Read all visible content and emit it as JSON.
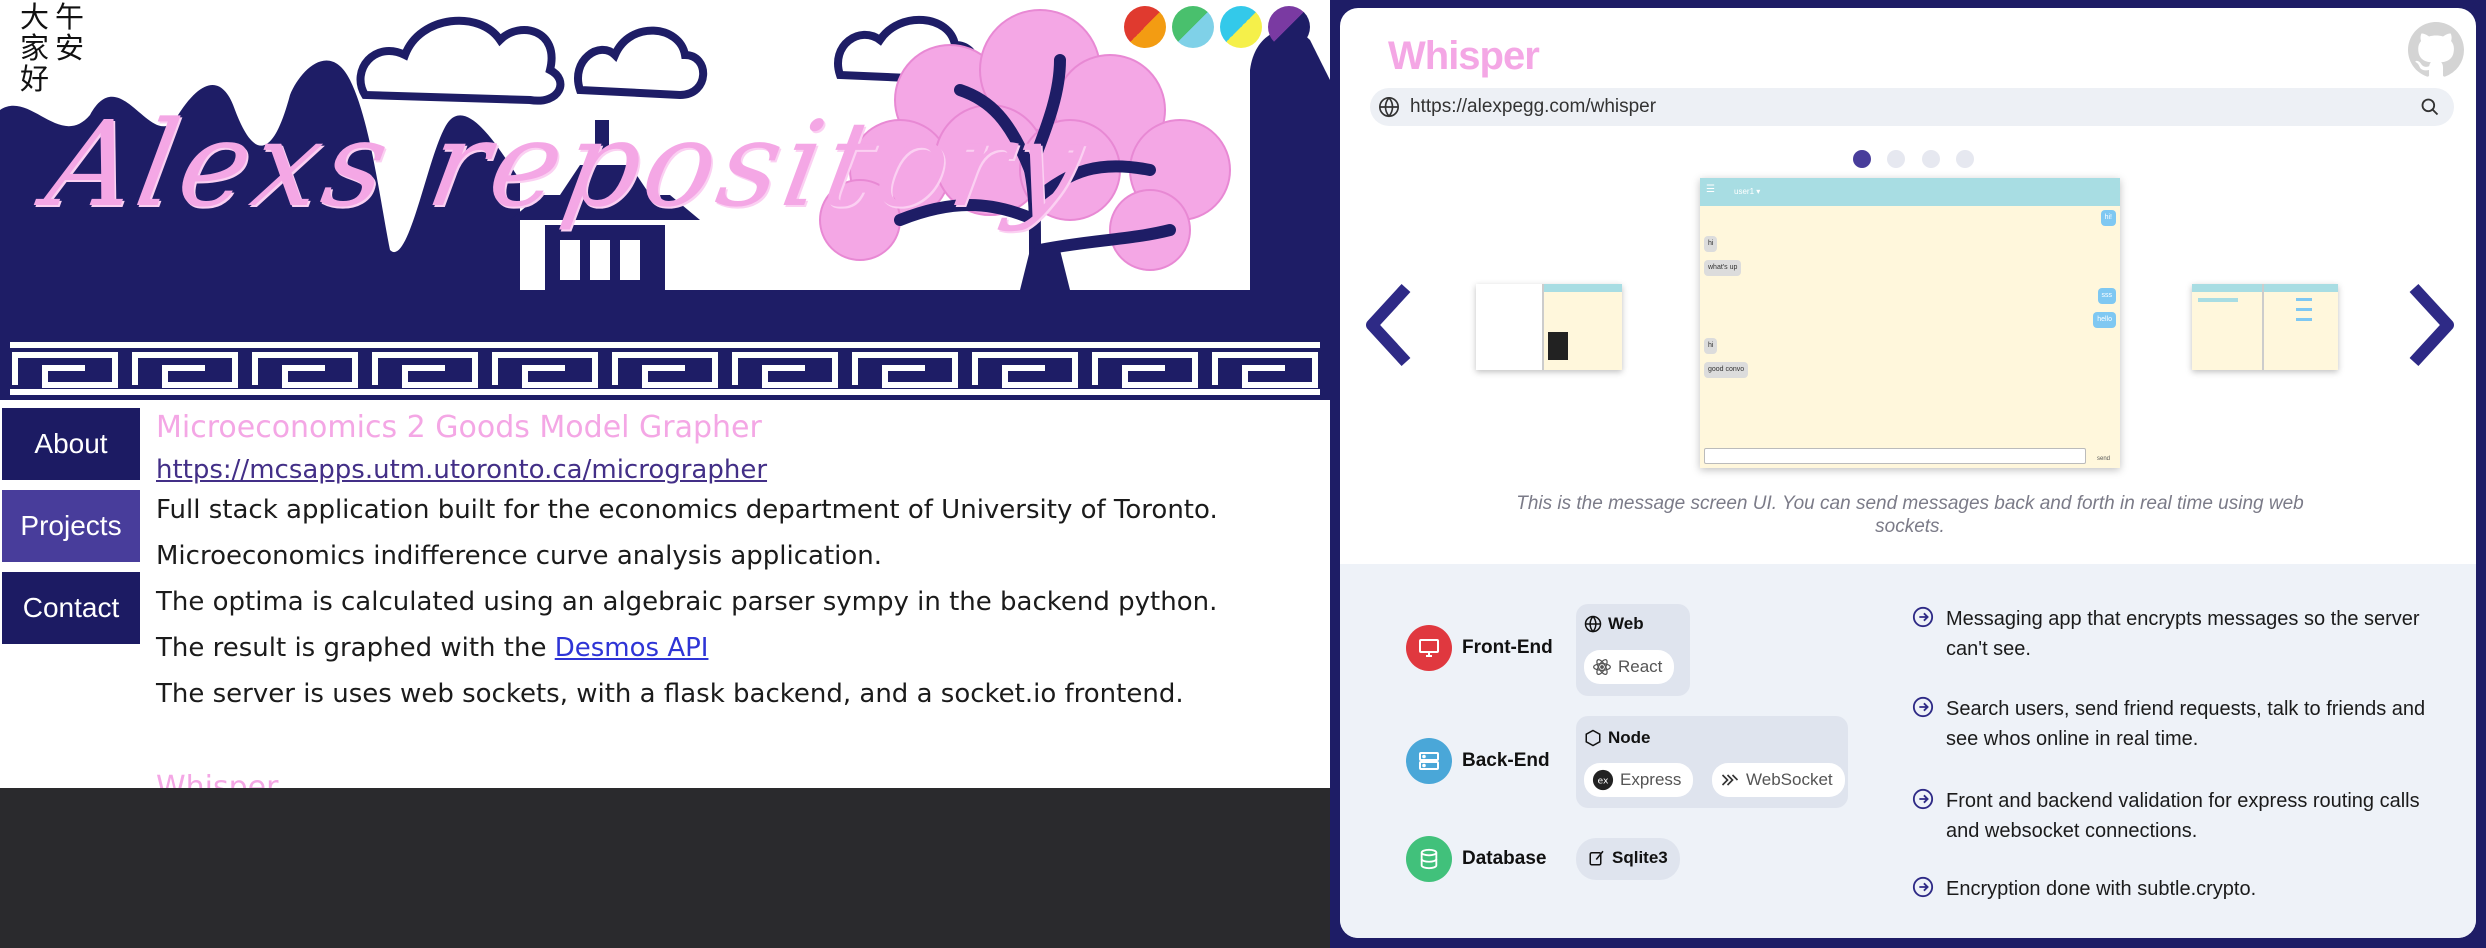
{
  "left_page": {
    "calligraphy": "大午\n家安\n好",
    "banner_title": "Alexs repository",
    "theme_colors": [
      "#e03a2f",
      "#49c06d",
      "#33c9ea",
      "#7a3aa2"
    ],
    "nav": [
      {
        "label": "About"
      },
      {
        "label": "Projects"
      },
      {
        "label": "Contact"
      }
    ],
    "project": {
      "title": "Microeconomics 2 Goods Model Grapher",
      "link": "https://mcsapps.utm.utoronto.ca/micrographer",
      "lines": [
        "Full stack application built for the economics department of University of Toronto.",
        "Microeconomics indifference curve analysis application.",
        "The optima is calculated using an algebraic parser sympy in the backend python."
      ],
      "result_prefix": "The result is graphed with the ",
      "result_link": "Desmos API",
      "server_line": "The server is uses web sockets, with a flask backend, and a socket.io frontend."
    },
    "next_project_title": "Whisper"
  },
  "right_panel": {
    "title": "Whisper",
    "url": "https://alexpegg.com/whisper",
    "carousel": {
      "slide_count": 4,
      "active_index": 0,
      "caption": "This is the message screen UI. You can send messages back and forth in real time using web sockets.",
      "mock": {
        "header": "user1 ▾",
        "outgoing": [
          "hi!",
          "sss",
          "hello"
        ],
        "incoming": [
          "hi",
          "what's up",
          "hi",
          "good convo"
        ],
        "send": "send"
      }
    },
    "stack": {
      "frontend": {
        "label": "Front-End",
        "group": "Web",
        "items": [
          "React"
        ]
      },
      "backend": {
        "label": "Back-End",
        "group": "Node",
        "items": [
          "Express",
          "WebSocket"
        ]
      },
      "database": {
        "label": "Database",
        "items": [
          "Sqlite3"
        ]
      }
    },
    "features": [
      "Messaging app that encrypts messages so the server can't see.",
      "Search users, send friend requests, talk to friends and see whos online in real time.",
      "Front and backend validation for express routing calls and websocket connections.",
      "Encryption done with subtle.crypto."
    ],
    "colors": {
      "accent_pink": "#f4a7e5",
      "navy": "#1e1d66",
      "frontend_icon": "#e0383f",
      "backend_icon": "#4aa7d8",
      "database_icon": "#41c17b"
    }
  }
}
